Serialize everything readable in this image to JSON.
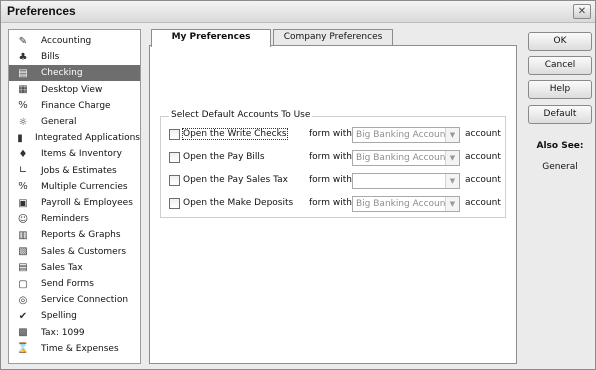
{
  "window": {
    "title": "Preferences",
    "close_icon": "close-icon"
  },
  "sidebar": {
    "selected_index": 2,
    "items": [
      {
        "label": "Accounting",
        "icon": "accounting-icon",
        "glyph": "✎"
      },
      {
        "label": "Bills",
        "icon": "bills-icon",
        "glyph": "♣"
      },
      {
        "label": "Checking",
        "icon": "checking-icon",
        "glyph": "▤"
      },
      {
        "label": "Desktop View",
        "icon": "desktop-view-icon",
        "glyph": "▦"
      },
      {
        "label": "Finance Charge",
        "icon": "finance-charge-icon",
        "glyph": "%"
      },
      {
        "label": "General",
        "icon": "general-icon",
        "glyph": "☼"
      },
      {
        "label": "Integrated Applications",
        "icon": "integrated-applications-icon",
        "glyph": "▮"
      },
      {
        "label": "Items & Inventory",
        "icon": "items-inventory-icon",
        "glyph": "♦"
      },
      {
        "label": "Jobs & Estimates",
        "icon": "jobs-estimates-icon",
        "glyph": "∟"
      },
      {
        "label": "Multiple Currencies",
        "icon": "multiple-currencies-icon",
        "glyph": "%"
      },
      {
        "label": "Payroll & Employees",
        "icon": "payroll-employees-icon",
        "glyph": "▣"
      },
      {
        "label": "Reminders",
        "icon": "reminders-icon",
        "glyph": "☺"
      },
      {
        "label": "Reports & Graphs",
        "icon": "reports-graphs-icon",
        "glyph": "▥"
      },
      {
        "label": "Sales & Customers",
        "icon": "sales-customers-icon",
        "glyph": "▧"
      },
      {
        "label": "Sales Tax",
        "icon": "sales-tax-icon",
        "glyph": "▤"
      },
      {
        "label": "Send Forms",
        "icon": "send-forms-icon",
        "glyph": "▢"
      },
      {
        "label": "Service Connection",
        "icon": "service-connection-icon",
        "glyph": "◎"
      },
      {
        "label": "Spelling",
        "icon": "spelling-icon",
        "glyph": "✔"
      },
      {
        "label": "Tax: 1099",
        "icon": "tax-1099-icon",
        "glyph": "▩"
      },
      {
        "label": "Time & Expenses",
        "icon": "time-expenses-icon",
        "glyph": "⌛"
      }
    ]
  },
  "tabs": [
    {
      "label": "My Preferences",
      "active": true
    },
    {
      "label": "Company Preferences",
      "active": false
    }
  ],
  "group": {
    "title": "Select Default Accounts To Use",
    "rows": [
      {
        "label": "Open the Write Checks",
        "form_with": "form with",
        "value": "Big Banking Account",
        "account": "account",
        "focused": true
      },
      {
        "label": "Open the Pay Bills",
        "form_with": "form with",
        "value": "Big Banking Account",
        "account": "account",
        "focused": false
      },
      {
        "label": "Open the Pay Sales Tax",
        "form_with": "form with",
        "value": "",
        "account": "account",
        "focused": false
      },
      {
        "label": "Open the Make Deposits",
        "form_with": "form with",
        "value": "Big Banking Account",
        "account": "account",
        "focused": false
      }
    ]
  },
  "buttons": {
    "ok": "OK",
    "cancel": "Cancel",
    "help": "Help",
    "default": "Default"
  },
  "also_see": {
    "title": "Also See:",
    "link": "General"
  }
}
